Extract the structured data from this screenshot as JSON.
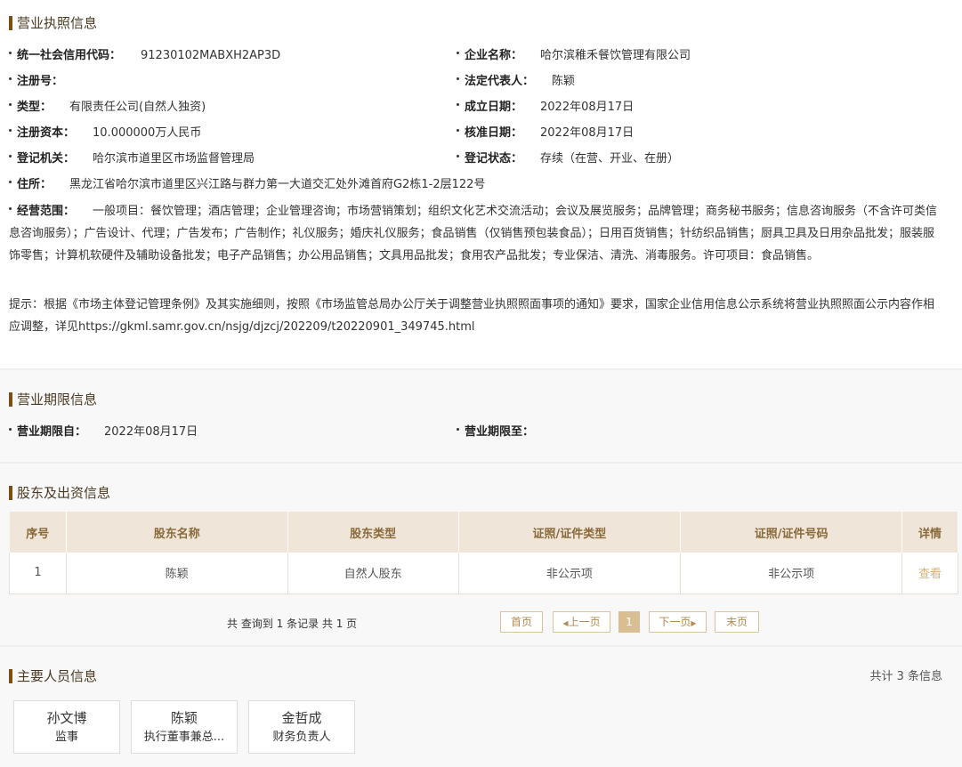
{
  "license": {
    "title": "营业执照信息",
    "credit_code_label": "统一社会信用代码：",
    "credit_code": "91230102MABXH2AP3D",
    "company_name_label": "企业名称：",
    "company_name": "哈尔滨稚禾餐饮管理有限公司",
    "reg_no_label": "注册号：",
    "reg_no": "",
    "legal_rep_label": "法定代表人：",
    "legal_rep": "陈颖",
    "type_label": "类型：",
    "type": "有限责任公司(自然人独资)",
    "established_label": "成立日期：",
    "established": "2022年08月17日",
    "capital_label": "注册资本：",
    "capital": "10.000000万人民币",
    "approved_label": "核准日期：",
    "approved": "2022年08月17日",
    "authority_label": "登记机关：",
    "authority": "哈尔滨市道里区市场监督管理局",
    "status_label": "登记状态：",
    "status": "存续（在营、开业、在册）",
    "address_label": "住所：",
    "address": "黑龙江省哈尔滨市道里区兴江路与群力第一大道交汇处外滩首府G2栋1-2层122号",
    "scope_label": "经营范围：",
    "scope": "一般项目：餐饮管理；酒店管理；企业管理咨询；市场营销策划；组织文化艺术交流活动；会议及展览服务；品牌管理；商务秘书服务；信息咨询服务（不含许可类信息咨询服务）；广告设计、代理；广告发布；广告制作；礼仪服务；婚庆礼仪服务；食品销售（仅销售预包装食品）；日用百货销售；针纺织品销售；厨具卫具及日用杂品批发；服装服饰零售；计算机软硬件及辅助设备批发；电子产品销售；办公用品销售；文具用品批发；食用农产品批发；专业保洁、清洗、消毒服务。许可项目：食品销售。",
    "notice": "提示：根据《市场主体登记管理条例》及其实施细则，按照《市场监管总局办公厅关于调整营业执照照面事项的通知》要求，国家企业信用信息公示系统将营业执照照面公示内容作相应调整，详见https://gkml.samr.gov.cn/nsjg/djzcj/202209/t20220901_349745.html"
  },
  "period": {
    "title": "营业期限信息",
    "from_label": "营业期限自：",
    "from": "2022年08月17日",
    "to_label": "营业期限至：",
    "to": ""
  },
  "shareholders": {
    "title": "股东及出资信息",
    "columns": [
      "序号",
      "股东名称",
      "股东类型",
      "证照/证件类型",
      "证照/证件号码",
      "详情"
    ],
    "rows": [
      {
        "no": "1",
        "name": "陈颖",
        "type": "自然人股东",
        "cert_type": "非公示项",
        "cert_no": "非公示项",
        "detail": "查看"
      }
    ],
    "record_info": "共 查询到 1 条记录 共 1 页",
    "pager": {
      "first": "首页",
      "prev": "上一页",
      "current": "1",
      "next": "下一页",
      "last": "末页"
    }
  },
  "staff": {
    "title": "主要人员信息",
    "total": "共计 3 条信息",
    "people": [
      {
        "name": "孙文博",
        "role": "监事"
      },
      {
        "name": "陈颖",
        "role": "执行董事兼总..."
      },
      {
        "name": "金哲成",
        "role": "财务负责人"
      }
    ]
  }
}
